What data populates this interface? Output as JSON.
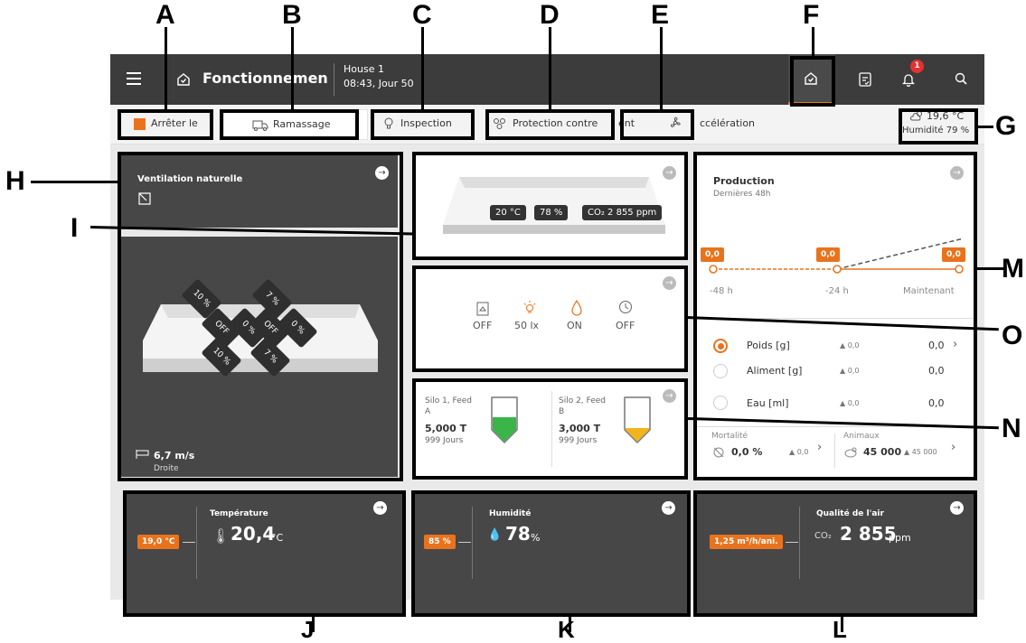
{
  "callouts": {
    "A": "A",
    "B": "B",
    "C": "C",
    "D": "D",
    "E": "E",
    "F": "F",
    "G": "G",
    "H": "H",
    "I": "I",
    "J": "J",
    "K": "K",
    "L": "L",
    "M": "M",
    "N": "N",
    "O": "O"
  },
  "header": {
    "title": "Fonctionnement",
    "house": "House 1",
    "time": "08:43, Jour 50",
    "notification_count": "1"
  },
  "subbar": {
    "stop": "Arrêter le",
    "pickup": "Ramassage",
    "inspection": "Inspection",
    "protection": "Protection contre",
    "ent_fragment": "ent",
    "acceleration": "ccélération",
    "weather_temp": "19,6 °C",
    "weather_humidity": "Humidité 79 %"
  },
  "ventilation": {
    "title": "Ventilation naturelle",
    "wind_speed": "6,7 m/s",
    "wind_dir": "Droite",
    "vents": [
      "10 %",
      "7 %",
      "OFF",
      "0 %",
      "OFF",
      "0 %",
      "10 %",
      "7 %"
    ]
  },
  "house_view": {
    "temp": "20 °C",
    "humidity": "78 %",
    "co2": "CO₂ 2 855 ppm"
  },
  "devices": [
    {
      "icon": "feeder-icon",
      "state": "OFF"
    },
    {
      "icon": "light-icon",
      "state": "50 lx"
    },
    {
      "icon": "water-drop-icon",
      "state": "ON"
    },
    {
      "icon": "timer-icon",
      "state": "OFF"
    }
  ],
  "silos": [
    {
      "name": "Silo 1, Feed A",
      "amount": "5,000 T",
      "days": "999 Jours",
      "color": "#3bb54a",
      "fill": 0.55
    },
    {
      "name": "Silo 2, Feed B",
      "amount": "3,000 T",
      "days": "999 Jours",
      "color": "#f0b41e",
      "fill": 0.3
    }
  ],
  "production": {
    "title": "Production",
    "subtitle": "Dernières 48h",
    "point_values": [
      "0,0",
      "0,0",
      "0,0"
    ],
    "axis_labels": [
      "-48 h",
      "-24 h",
      "Maintenant"
    ],
    "rows": [
      {
        "label": "Poids [g]",
        "delta": "▲ 0,0",
        "value": "0,0",
        "selected": true,
        "chevron": "›"
      },
      {
        "label": "Aliment [g]",
        "delta": "▲ 0,0",
        "value": "0,0",
        "selected": false,
        "chevron": ""
      },
      {
        "label": "Eau [ml]",
        "delta": "▲ 0,0",
        "value": "0,0",
        "selected": false,
        "chevron": ""
      }
    ],
    "mortality_label": "Mortalité",
    "mortality_value": "0,0 %",
    "mortality_delta": "▲ 0,0",
    "animals_label": "Animaux",
    "animals_value": "45 000",
    "animals_delta": "▲ 45 000"
  },
  "temperature": {
    "title": "Température",
    "setpoint": "19,0 °C",
    "value": "20,4",
    "unit": "°C"
  },
  "humidity": {
    "title": "Humidité",
    "setpoint": "85 %",
    "value": "78",
    "unit": "%"
  },
  "air": {
    "title": "Qualité de l'air",
    "setpoint": "1,25 m³/h/ani.",
    "prefix": "CO₂",
    "value": "2 855",
    "unit": "ppm"
  },
  "colors": {
    "accent": "#e8731e",
    "dark": "#3c3c3c",
    "card": "#474747"
  }
}
